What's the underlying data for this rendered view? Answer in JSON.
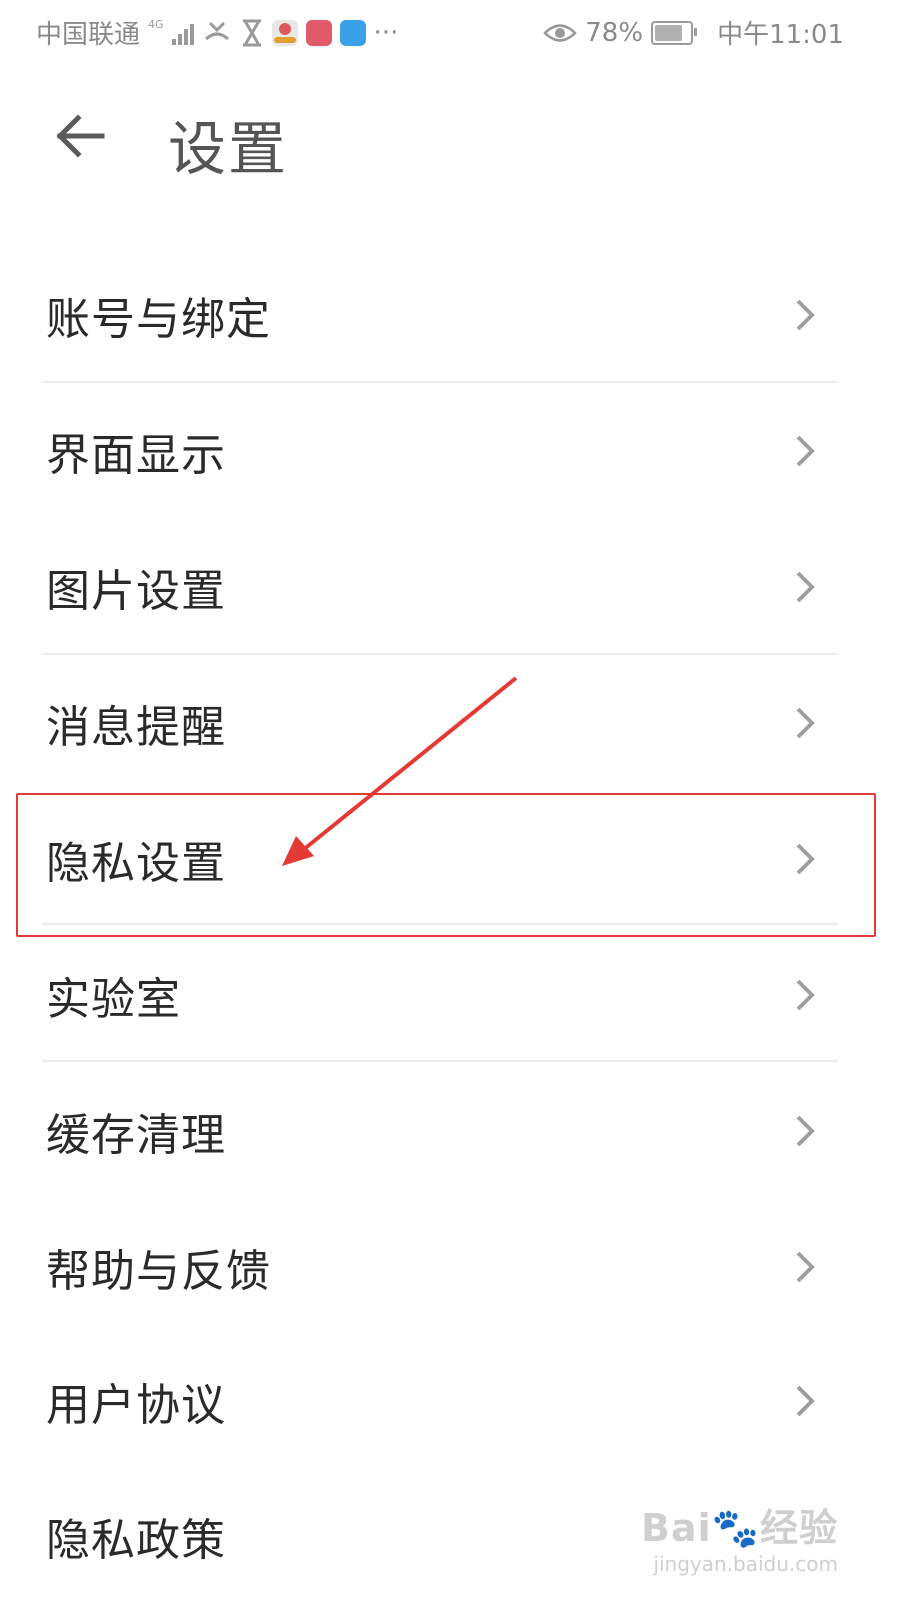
{
  "status_bar": {
    "carrier": "中国联通",
    "network": "4G",
    "battery_percent": "78%",
    "battery_level": 0.78,
    "time": "中午11:01",
    "more": "···",
    "icons": [
      "signal-icon",
      "missed-call-icon",
      "hourglass-icon",
      "map-app-icon",
      "red-app-icon",
      "blue-app-icon",
      "eye-icon",
      "battery-icon"
    ]
  },
  "header": {
    "title": "设置",
    "back_icon": "arrow-left-icon"
  },
  "menu": {
    "items": [
      {
        "label": "账号与绑定"
      },
      {
        "label": "界面显示"
      },
      {
        "label": "图片设置"
      },
      {
        "label": "消息提醒"
      },
      {
        "label": "隐私设置"
      },
      {
        "label": "实验室"
      },
      {
        "label": "缓存清理"
      },
      {
        "label": "帮助与反馈"
      },
      {
        "label": "用户协议"
      },
      {
        "label": "隐私政策"
      }
    ],
    "chevron_icon": "chevron-right-icon"
  },
  "annotation": {
    "highlighted_item": "隐私设置",
    "color": "#e53935"
  },
  "watermark": {
    "brand": "Bai",
    "brand_suffix": "经验",
    "url": "jingyan.baidu.com"
  },
  "colors": {
    "title": "#555555",
    "label": "#2a2a2a",
    "chevron": "#9e9e9e",
    "divider": "#ececec",
    "status_text": "#8a8a8a"
  }
}
